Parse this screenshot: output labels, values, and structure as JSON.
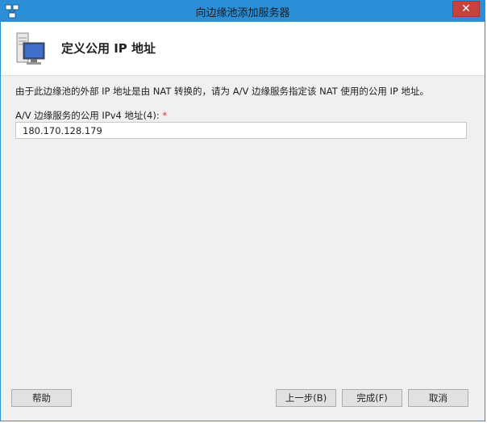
{
  "window": {
    "title": "向边缘池添加服务器",
    "close_glyph": "✕",
    "titlebar_color": "#2b8fd8",
    "close_color": "#c7423c"
  },
  "header": {
    "title": "定义公用 IP 地址"
  },
  "content": {
    "description": "由于此边缘池的外部 IP 地址是由 NAT 转换的，请为 A/V 边缘服务指定该 NAT 使用的公用 IP 地址。",
    "ipv4_label": "A/V 边缘服务的公用 IPv4 地址(4):",
    "required_marker": "*",
    "ipv4_value": "180.170.128.179"
  },
  "buttons": {
    "help": "帮助",
    "previous": "上一步(B)",
    "finish": "完成(F)",
    "cancel": "取消"
  },
  "icons": {
    "app": "topology-app-icon",
    "header": "server-monitor-icon",
    "close": "close-icon"
  }
}
